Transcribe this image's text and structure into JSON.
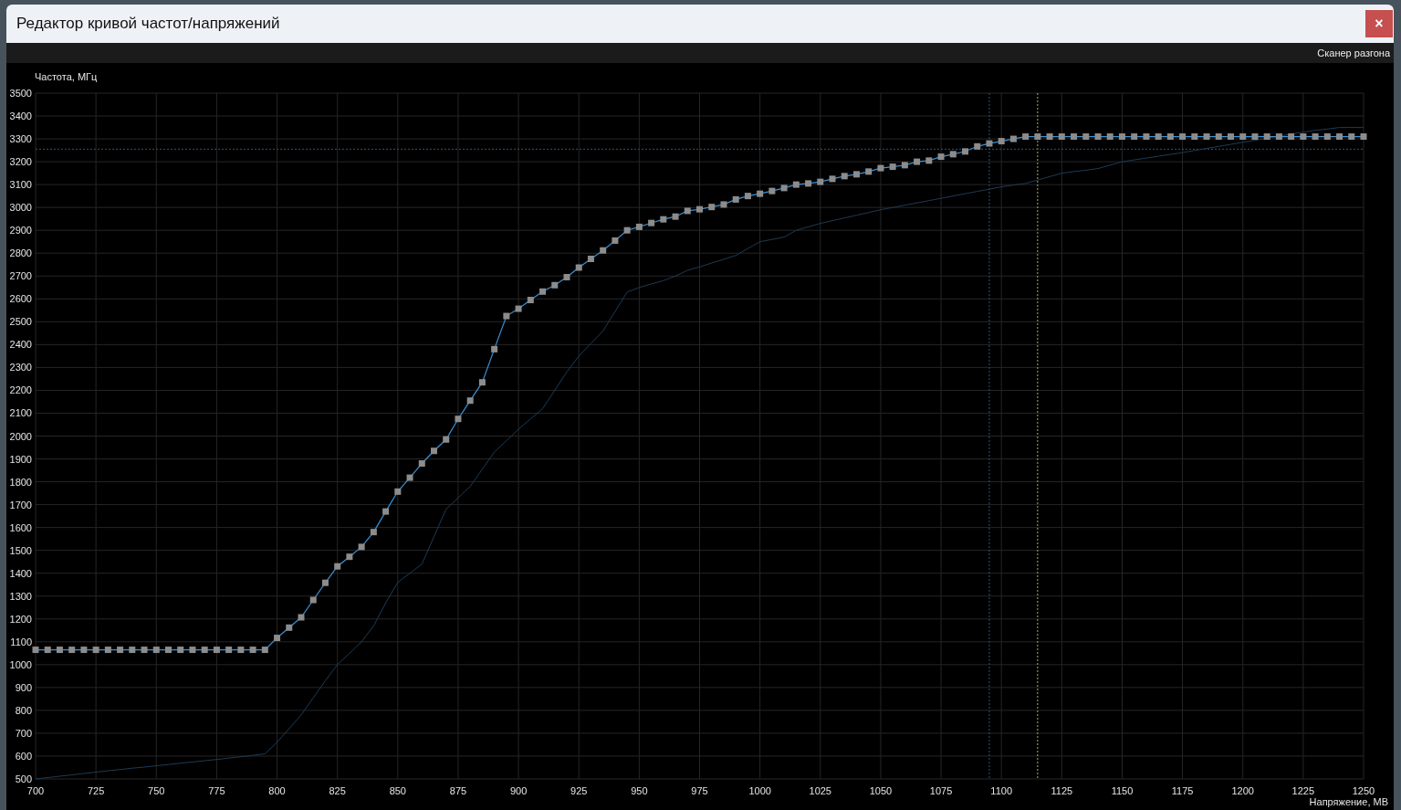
{
  "window": {
    "title": "Редактор кривой частот/напряжений",
    "close_label": "×"
  },
  "toolbar": {
    "items": [
      "Сканер разгона"
    ]
  },
  "chart": {
    "chart_data": {
      "type": "line",
      "xlabel": "Напряжение, МВ",
      "ylabel": "Частота, МГц",
      "xlim": [
        700,
        1250
      ],
      "ylim": [
        500,
        3500
      ],
      "xticks": [
        700,
        725,
        750,
        775,
        800,
        825,
        850,
        875,
        900,
        925,
        950,
        975,
        1000,
        1025,
        1050,
        1075,
        1100,
        1125,
        1150,
        1175,
        1200,
        1225,
        1250
      ],
      "yticks": [
        500,
        600,
        700,
        800,
        900,
        1000,
        1100,
        1200,
        1300,
        1400,
        1500,
        1600,
        1700,
        1800,
        1900,
        2000,
        2100,
        2200,
        2300,
        2400,
        2500,
        2600,
        2700,
        2800,
        2900,
        3000,
        3100,
        3200,
        3300,
        3400,
        3500
      ],
      "x": [
        700,
        705,
        710,
        715,
        720,
        725,
        730,
        735,
        740,
        745,
        750,
        755,
        760,
        765,
        770,
        775,
        780,
        785,
        790,
        795,
        800,
        805,
        810,
        815,
        820,
        825,
        830,
        835,
        840,
        845,
        850,
        855,
        860,
        865,
        870,
        875,
        880,
        885,
        890,
        895,
        900,
        905,
        910,
        915,
        920,
        925,
        930,
        935,
        940,
        945,
        950,
        955,
        960,
        965,
        970,
        975,
        980,
        985,
        990,
        995,
        1000,
        1005,
        1010,
        1015,
        1020,
        1025,
        1030,
        1035,
        1040,
        1045,
        1050,
        1055,
        1060,
        1065,
        1070,
        1075,
        1080,
        1085,
        1090,
        1095,
        1100,
        1105,
        1110,
        1115,
        1120,
        1125,
        1130,
        1135,
        1140,
        1145,
        1150,
        1155,
        1160,
        1165,
        1170,
        1175,
        1180,
        1185,
        1190,
        1195,
        1200,
        1205,
        1210,
        1215,
        1220,
        1225,
        1230,
        1235,
        1240,
        1245,
        1250
      ],
      "series": [
        {
          "color": "#3a92d6",
          "marker": "square",
          "values": [
            1065,
            1065,
            1065,
            1065,
            1065,
            1065,
            1065,
            1065,
            1065,
            1065,
            1065,
            1065,
            1065,
            1065,
            1065,
            1065,
            1065,
            1065,
            1065,
            1065,
            1117,
            1162,
            1207,
            1283,
            1358,
            1430,
            1472,
            1515,
            1580,
            1670,
            1757,
            1818,
            1880,
            1935,
            1985,
            2075,
            2155,
            2235,
            2380,
            2525,
            2557,
            2595,
            2632,
            2660,
            2695,
            2737,
            2775,
            2812,
            2855,
            2900,
            2915,
            2932,
            2948,
            2960,
            2985,
            2992,
            3002,
            3013,
            3035,
            3050,
            3060,
            3072,
            3085,
            3100,
            3105,
            3112,
            3125,
            3137,
            3145,
            3157,
            3172,
            3178,
            3185,
            3200,
            3205,
            3222,
            3233,
            3245,
            3267,
            3280,
            3290,
            3300,
            3310,
            3310,
            3310,
            3310,
            3310,
            3310,
            3310,
            3310,
            3310,
            3310,
            3310,
            3310,
            3310,
            3310,
            3310,
            3310,
            3310,
            3310,
            3310,
            3310,
            3310,
            3310,
            3310,
            3310,
            3310,
            3310,
            3310,
            3310,
            3310
          ]
        },
        {
          "color": "#1d3b56",
          "values": [
            500,
            506,
            512,
            518,
            524,
            530,
            536,
            541,
            547,
            552,
            558,
            563,
            569,
            574,
            580,
            585,
            591,
            597,
            603,
            610,
            660,
            720,
            780,
            855,
            930,
            1000,
            1050,
            1100,
            1170,
            1270,
            1360,
            1400,
            1440,
            1560,
            1680,
            1730,
            1780,
            1855,
            1930,
            1980,
            2030,
            2075,
            2120,
            2200,
            2280,
            2350,
            2405,
            2460,
            2545,
            2630,
            2650,
            2665,
            2680,
            2700,
            2725,
            2740,
            2757,
            2773,
            2790,
            2820,
            2850,
            2860,
            2870,
            2900,
            2915,
            2930,
            2942,
            2954,
            2966,
            2978,
            2990,
            3000,
            3010,
            3020,
            3030,
            3040,
            3050,
            3060,
            3070,
            3080,
            3090,
            3098,
            3105,
            3120,
            3135,
            3150,
            3157,
            3163,
            3170,
            3185,
            3200,
            3208,
            3216,
            3224,
            3232,
            3240,
            3249,
            3258,
            3267,
            3276,
            3285,
            3294,
            3303,
            3312,
            3321,
            3330,
            3337,
            3343,
            3350,
            3350,
            3350
          ]
        }
      ],
      "ref_lines": [
        {
          "axis": "x",
          "value": 1095,
          "color": "#2f5577"
        },
        {
          "axis": "x",
          "value": 1115,
          "color": "#b8ad6a"
        },
        {
          "axis": "y",
          "value": 3255,
          "color": "#2f5577"
        }
      ],
      "grid": true
    }
  }
}
